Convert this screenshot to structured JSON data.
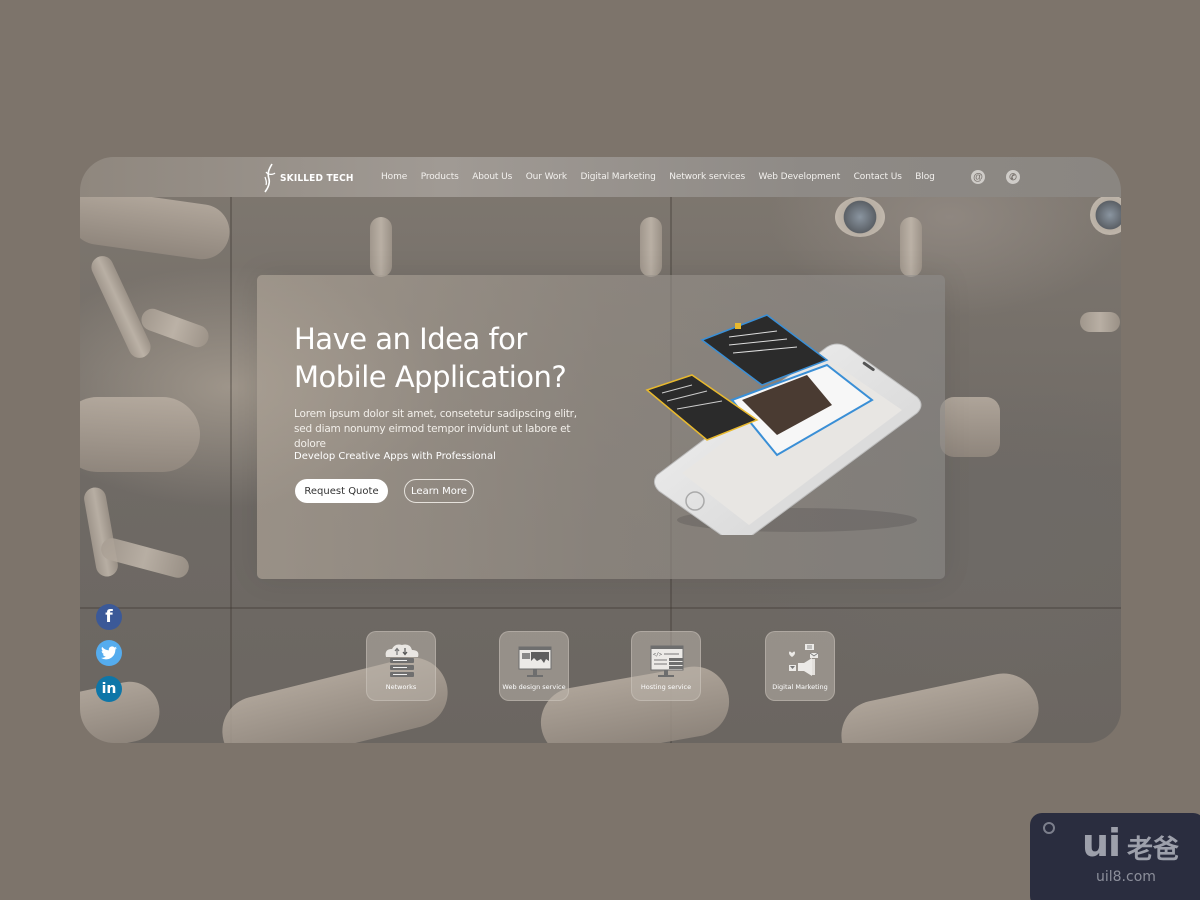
{
  "brand": {
    "name": "SKILLED TECH"
  },
  "nav": {
    "links": [
      "Home",
      "Products",
      "About Us",
      "Our Work",
      "Digital Marketing",
      "Network services",
      "Web Development",
      "Contact Us",
      "Blog"
    ],
    "icons": [
      {
        "name": "email-at-icon",
        "glyph": "@"
      },
      {
        "name": "phone-icon",
        "glyph": "✆"
      }
    ]
  },
  "hero": {
    "title_line1": "Have an Idea for",
    "title_line2": "Mobile Application?",
    "description": "Lorem ipsum dolor sit amet, consetetur sadipscing elitr, sed diam nonumy eirmod tempor invidunt ut labore et dolore",
    "subtitle": "Develop Creative Apps with Professional",
    "primary_button": "Request Quote",
    "secondary_button": "Learn More"
  },
  "social": [
    {
      "name": "facebook",
      "glyph": "f",
      "color": "#3b5998"
    },
    {
      "name": "twitter",
      "glyph": "",
      "color": "#55acee"
    },
    {
      "name": "linkedin",
      "glyph": "in",
      "color": "#0e76a8"
    }
  ],
  "services": [
    {
      "label": "Networks",
      "icon": "cloud-server-icon"
    },
    {
      "label": "Web design service",
      "icon": "web-design-monitor-icon"
    },
    {
      "label": "Hosting service",
      "icon": "hosting-code-icon"
    },
    {
      "label": "Digital Marketing",
      "icon": "megaphone-icon"
    }
  ],
  "watermark": {
    "logo": "ui",
    "cn": "老爸",
    "url": "uil8.com"
  },
  "colors": {
    "page_bg": "#7d746b",
    "facebook": "#3b5998",
    "twitter": "#55acee",
    "linkedin": "#0e76a8",
    "watermark_bg": "#2a2d3f"
  }
}
